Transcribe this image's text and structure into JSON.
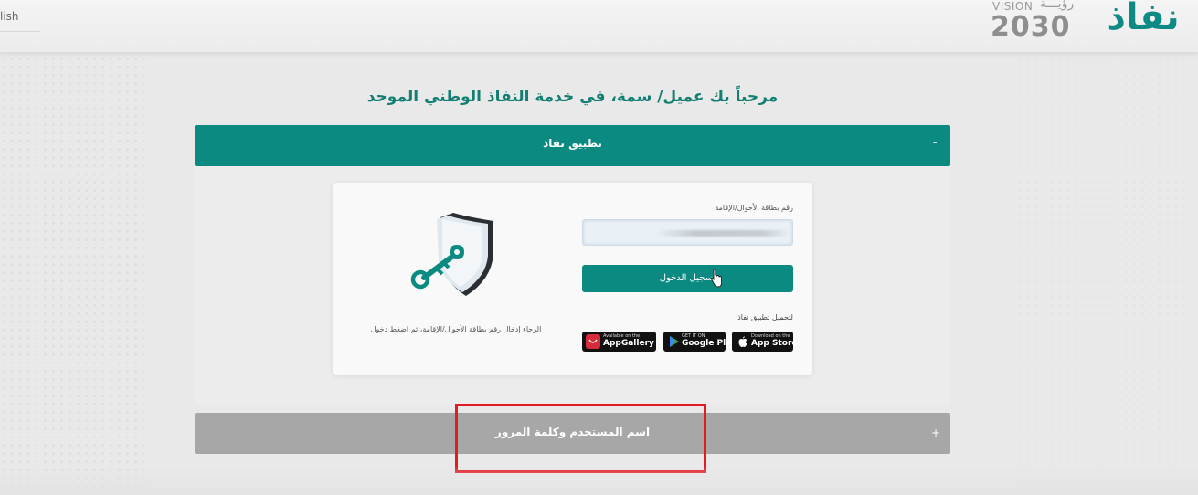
{
  "header": {
    "lang_link": "lish",
    "vision_word": "VISION",
    "vision_ar": "رؤيـــة",
    "vision_year": "2030",
    "brand_ar": "نفاذ"
  },
  "page_title": "مرحباً بك عميل/ سمة، في خدمة النفاذ الوطني الموحد",
  "accordion_app": {
    "label": "تطبيق نفاذ",
    "toggle": "-"
  },
  "login_card": {
    "id_label": "رقم بطاقة الأحوال/الإقامة",
    "id_value": "",
    "login_button": "تسجيل الدخول",
    "download_label": "لتحميل تطبيق نفاذ",
    "instructions": "الرجاء إدخال رقم بطاقة الأحوال/الإقامة، ثم اضغط دخول",
    "stores": [
      {
        "small": "Available on the",
        "big": "AppGallery",
        "icon": "huawei-icon"
      },
      {
        "small": "GET IT ON",
        "big": "Google Play",
        "icon": "google-play-icon"
      },
      {
        "small": "Download on the",
        "big": "App Store",
        "icon": "apple-icon"
      }
    ]
  },
  "accordion_password": {
    "label": "اسم المستخدم وكلمة المرور",
    "toggle": "+"
  },
  "colors": {
    "brand": "#0b8a82",
    "title": "#137f73",
    "highlight": "#e21b23"
  }
}
